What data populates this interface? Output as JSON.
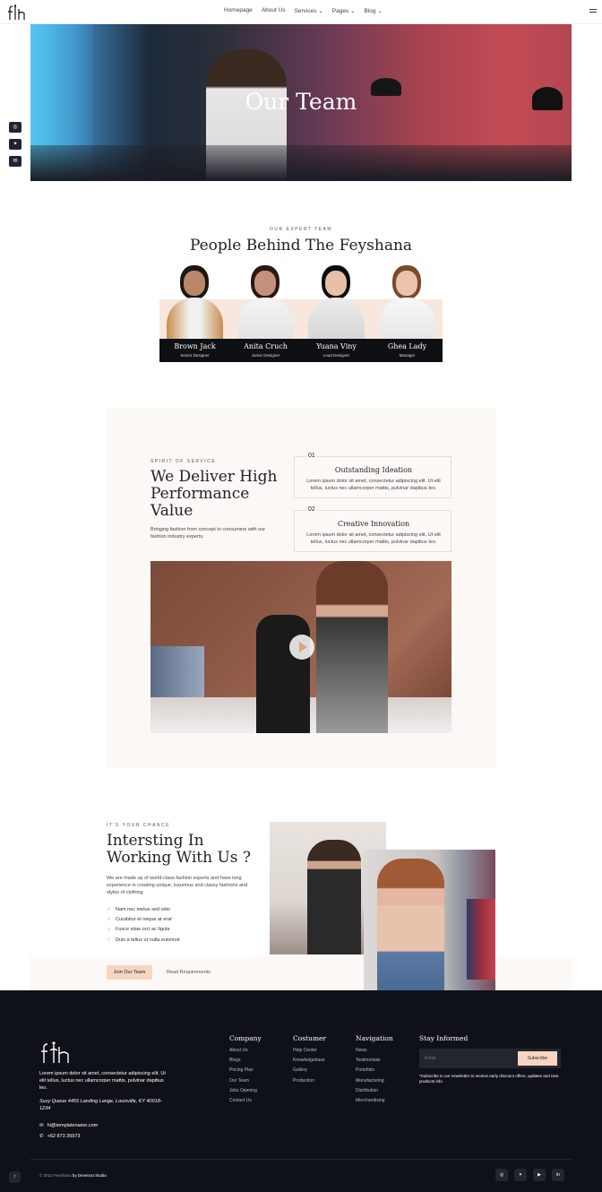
{
  "header": {
    "nav": [
      {
        "label": "Homepage"
      },
      {
        "label": "About Us"
      },
      {
        "label": "Services",
        "dropdown": true
      },
      {
        "label": "Pages",
        "dropdown": true
      },
      {
        "label": "Blog",
        "dropdown": true
      }
    ],
    "chevron": "⌄"
  },
  "hero": {
    "title": "Our Team"
  },
  "side_social": [
    {
      "icon": "instagram-icon",
      "glyph": "◎"
    },
    {
      "icon": "twitter-icon",
      "glyph": "✦"
    },
    {
      "icon": "mail-icon",
      "glyph": "✉"
    }
  ],
  "team": {
    "eyebrow": "OUR EXPERT TEAM",
    "title": "People Behind The Feyshana",
    "members": [
      {
        "name": "Brown Jack",
        "role": "Senior Designer"
      },
      {
        "name": "Anita Cruch",
        "role": "Junior Designer"
      },
      {
        "name": "Yuana Viny",
        "role": "Lead Designer"
      },
      {
        "name": "Ghea Lady",
        "role": "Manager"
      }
    ]
  },
  "spirit": {
    "eyebrow": "SPIRIT OF SERVICE",
    "title": "We Deliver High Performance Value",
    "desc": "Bringing fashion from concept to consumers with our fashion industry experts.",
    "cards": [
      {
        "num": "01",
        "title": "Outstanding Ideation",
        "desc": "Lorem ipsum dolor sit amet, consectetur adipiscing elit. Ut elit tellus, luctus nec ullamcorper mattis, pulvinar dapibus leo."
      },
      {
        "num": "02",
        "title": "Creative Innovation",
        "desc": "Lorem ipsum dolor sit amet, consectetur adipiscing elit. Ut elit tellus, luctus nec ullamcorper mattis, pulvinar dapibus leo."
      }
    ]
  },
  "interest": {
    "eyebrow": "IT'S YOUR CHANCE",
    "title": "Intersting In Working With Us ?",
    "desc": "We are made up of world-class fashion experts and have long experience in creating unique, luxurious and classy fashions and styles of clothing",
    "checks": [
      "Nam nec metus sed odio",
      "Curabitur et neque at erat",
      "Fusce vitae orci ac ligula",
      "Duis a tellus ut nulla euismod"
    ],
    "check_glyph": "✓",
    "join": "Join Our Team",
    "read": "Read Requirements"
  },
  "footer": {
    "desc": "Lorem ipsum dolor sit amet, consectetur adipiscing elit. Ut elit tellus, luctus nec ullamcorper mattis, pulvinar dapibus leo.",
    "address": "Suzy Queue 4455 Landing Lange, Louisville, KY 40018-1234",
    "email": "hi@templatename.com",
    "phone": "+62 873 35973",
    "email_glyph": "✉",
    "phone_glyph": "✆",
    "columns": [
      {
        "title": "Company",
        "items": [
          "About Us",
          "Blogs",
          "Pricing Plan",
          "Our Team",
          "Jobs Opening",
          "Contact Us"
        ]
      },
      {
        "title": "Costumer",
        "items": [
          "Help Center",
          "Knowledgebase",
          "Gallery",
          "Production"
        ]
      },
      {
        "title": "Navigation",
        "items": [
          "News",
          "Testimonials",
          "Portofolio",
          "Manufacturing",
          "Distribution",
          "Merchandising"
        ]
      }
    ],
    "stay": {
      "title": "Stay Informed",
      "placeholder": "Email",
      "button": "Subscribe",
      "note": "*Subscribe to our newsletter to receive early discount offers, updates and new products info."
    },
    "copyright": "© 2022 Feyshana",
    "by": "by Deverust Studio",
    "social": [
      {
        "icon": "instagram-icon",
        "glyph": "◎"
      },
      {
        "icon": "twitter-icon",
        "glyph": "✦"
      },
      {
        "icon": "youtube-icon",
        "glyph": "▶"
      },
      {
        "icon": "linkedin-icon",
        "glyph": "in"
      }
    ],
    "totop_glyph": "↑"
  },
  "colors": {
    "accent": "#f7d5c2",
    "dark": "#0e1117",
    "check": "#e2a27a"
  }
}
